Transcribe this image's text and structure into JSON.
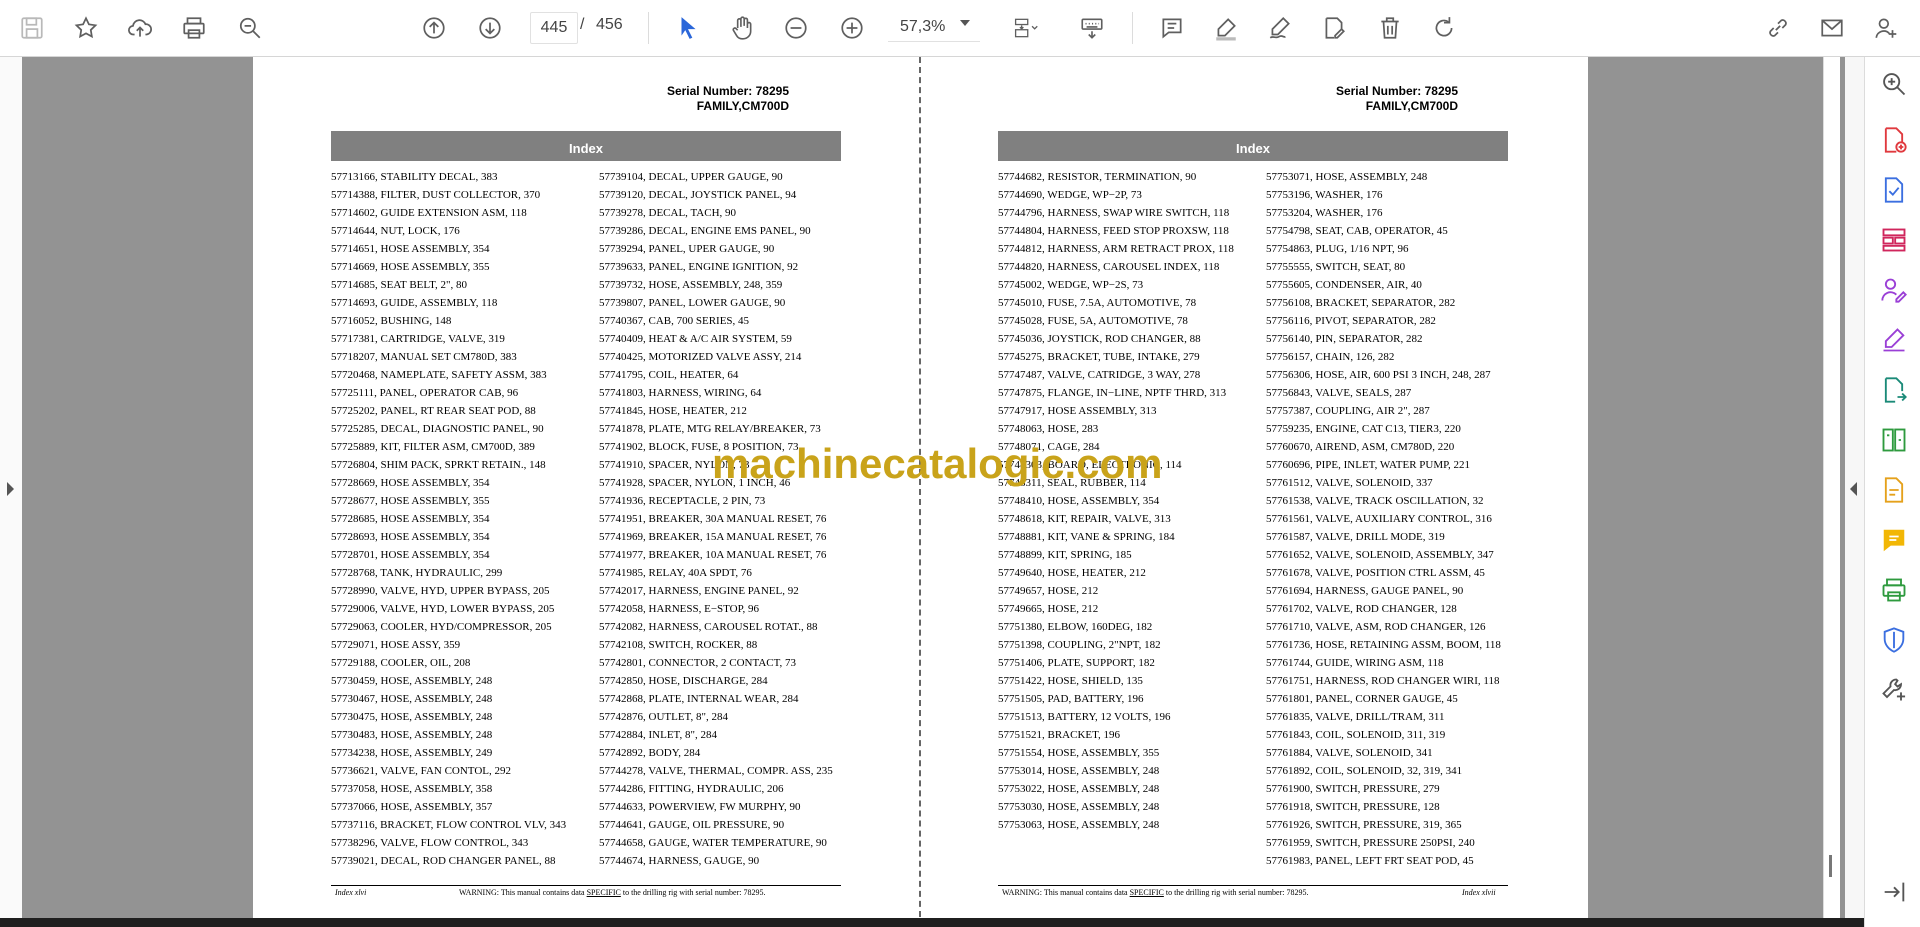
{
  "toolbar": {
    "page_current": "445",
    "page_separator": "/",
    "page_total": "456",
    "zoom": "57,3%"
  },
  "pages": [
    {
      "serial": "Serial Number: 78295",
      "family": "FAMILY,CM700D",
      "index_title": "Index",
      "col1": [
        "57713166, STABILITY DECAL, 383",
        "57714388, FILTER, DUST COLLECTOR, 370",
        "57714602, GUIDE EXTENSION ASM, 118",
        "57714644, NUT, LOCK, 176",
        "57714651, HOSE ASSEMBLY, 354",
        "57714669, HOSE ASSEMBLY, 355",
        "57714685, SEAT BELT, 2\", 80",
        "57714693, GUIDE, ASSEMBLY, 118",
        "57716052, BUSHING, 148",
        "57717381, CARTRIDGE, VALVE, 319",
        "57718207, MANUAL SET CM780D, 383",
        "57720468, NAMEPLATE, SAFETY ASSM, 383",
        "57725111, PANEL, OPERATOR CAB, 96",
        "57725202, PANEL, RT REAR SEAT POD, 88",
        "57725285, DECAL, DIAGNOSTIC PANEL, 90",
        "57725889, KIT, FILTER ASM, CM700D, 389",
        "57726804, SHIM PACK, SPRKT RETAIN., 148",
        "57728669, HOSE ASSEMBLY, 354",
        "57728677, HOSE ASSEMBLY, 355",
        "57728685, HOSE ASSEMBLY, 354",
        "57728693, HOSE ASSEMBLY, 354",
        "57728701, HOSE ASSEMBLY, 354",
        "57728768, TANK, HYDRAULIC, 299",
        "57728990, VALVE, HYD, UPPER BYPASS, 205",
        "57729006, VALVE, HYD, LOWER BYPASS, 205",
        "57729063, COOLER, HYD/COMPRESSOR, 205",
        "57729071, HOSE ASSY, 359",
        "57729188, COOLER, OIL, 208",
        "57730459, HOSE, ASSEMBLY, 248",
        "57730467, HOSE, ASSEMBLY, 248",
        "57730475, HOSE, ASSEMBLY, 248",
        "57730483, HOSE, ASSEMBLY, 248",
        "57734238, HOSE, ASSEMBLY, 249",
        "57736621, VALVE, FAN CONTOL, 292",
        "57737058, HOSE, ASSEMBLY, 358",
        "57737066, HOSE, ASSEMBLY, 357",
        "57737116, BRACKET, FLOW CONTROL VLV, 343",
        "57738296, VALVE, FLOW CONTROL, 343",
        "57739021, DECAL, ROD CHANGER PANEL, 88"
      ],
      "col2": [
        "57739104, DECAL, UPPER GAUGE, 90",
        "57739120, DECAL, JOYSTICK PANEL, 94",
        "57739278, DECAL, TACH, 90",
        "57739286, DECAL, ENGINE EMS PANEL, 90",
        "57739294, PANEL, UPER GAUGE, 90",
        "57739633, PANEL, ENGINE IGNITION, 92",
        "57739732, HOSE, ASSEMBLY, 248, 359",
        "57739807, PANEL, LOWER GAUGE, 90",
        "57740367, CAB, 700 SERIES, 45",
        "57740409, HEAT & A/C AIR SYSTEM, 59",
        "57740425, MOTORIZED VALVE ASSY, 214",
        "57741795, COIL, HEATER, 64",
        "57741803, HARNESS, WIRING, 64",
        "57741845, HOSE, HEATER, 212",
        "57741878, PLATE, MTG RELAY/BREAKER, 73",
        "57741902, BLOCK, FUSE, 8 POSITION, 73",
        "57741910, SPACER, NYLON, 73",
        "57741928, SPACER, NYLON, 1 INCH, 46",
        "57741936, RECEPTACLE, 2 PIN, 73",
        "57741951, BREAKER, 30A MANUAL RESET, 76",
        "57741969, BREAKER, 15A MANUAL RESET, 76",
        "57741977, BREAKER, 10A MANUAL RESET, 76",
        "57741985, RELAY, 40A SPDT, 76",
        "57742017, HARNESS, ENGINE PANEL, 92",
        "57742058, HARNESS, E−STOP, 96",
        "57742082, HARNESS, CAROUSEL ROTAT., 88",
        "57742108, SWITCH, ROCKER, 88",
        "57742801, CONNECTOR, 2 CONTACT, 73",
        "57742850, HOSE, DISCHARGE, 284",
        "57742868, PLATE, INTERNAL WEAR, 284",
        "57742876, OUTLET, 8\", 284",
        "57742884, INLET, 8\", 284",
        "57742892, BODY, 284",
        "57744278, VALVE, THERMAL, COMPR. ASS, 235",
        "57744286, FITTING, HYDRAULIC, 206",
        "57744633, POWERVIEW, FW MURPHY, 90",
        "57744641, GAUGE, OIL PRESSURE, 90",
        "57744658, GAUGE, WATER TEMPERATURE, 90",
        "57744674, HARNESS, GAUGE, 90"
      ],
      "footer_left": "Index xlvi",
      "footer_warning_pre": "WARNING:  This manual contains data ",
      "footer_warning_u": "SPECIFIC",
      "footer_warning_post": " to the drilling rig with serial number: 78295."
    },
    {
      "serial": "Serial Number: 78295",
      "family": "FAMILY,CM700D",
      "index_title": "Index",
      "col1": [
        "57744682, RESISTOR, TERMINATION, 90",
        "57744690, WEDGE, WP−2P, 73",
        "57744796, HARNESS, SWAP WIRE SWITCH, 118",
        "57744804, HARNESS, FEED STOP PROXSW, 118",
        "57744812, HARNESS, ARM RETRACT PROX, 118",
        "57744820, HARNESS, CAROUSEL INDEX, 118",
        "57745002, WEDGE, WP−2S, 73",
        "57745010, FUSE, 7.5A, AUTOMOTIVE, 78",
        "57745028, FUSE, 5A, AUTOMOTIVE, 78",
        "57745036, JOYSTICK, ROD CHANGER, 88",
        "57745275, BRACKET, TUBE, INTAKE, 279",
        "57747487, VALVE, CATRIDGE, 3 WAY, 278",
        "57747875, FLANGE, IN−LINE, NPTF THRD, 313",
        "57747917, HOSE ASSEMBLY, 313",
        "57748063, HOSE, 283",
        "57748071, CAGE, 284",
        "57748303, BOARD, ELECTRONIC, 114",
        "57748311, SEAL, RUBBER, 114",
        "57748410, HOSE, ASSEMBLY, 354",
        "57748618, KIT, REPAIR, VALVE, 313",
        "57748881, KIT, VANE & SPRING, 184",
        "57748899, KIT, SPRING, 185",
        "57749640, HOSE, HEATER, 212",
        "57749657, HOSE, 212",
        "57749665, HOSE, 212",
        "57751380, ELBOW, 160DEG, 182",
        "57751398, COUPLING, 2\"NPT, 182",
        "57751406, PLATE, SUPPORT, 182",
        "57751422, HOSE, SHIELD, 135",
        "57751505, PAD, BATTERY, 196",
        "57751513, BATTERY, 12 VOLTS, 196",
        "57751521, BRACKET, 196",
        "57751554, HOSE, ASSEMBLY, 355",
        "57753014, HOSE, ASSEMBLY, 248",
        "57753022, HOSE, ASSEMBLY, 248",
        "57753030, HOSE, ASSEMBLY, 248",
        "57753063, HOSE, ASSEMBLY, 248"
      ],
      "col2": [
        "57753071, HOSE, ASSEMBLY, 248",
        "57753196, WASHER, 176",
        "57753204, WASHER, 176",
        "57754798, SEAT, CAB, OPERATOR, 45",
        "57754863, PLUG, 1/16 NPT, 96",
        "57755555, SWITCH, SEAT, 80",
        "57755605, CONDENSER, AIR, 40",
        "57756108, BRACKET, SEPARATOR, 282",
        "57756116, PIVOT, SEPARATOR, 282",
        "57756140, PIN, SEPARATOR, 282",
        "57756157, CHAIN, 126, 282",
        "57756306, HOSE, AIR, 600 PSI 3 INCH, 248, 287",
        "57756843, VALVE, SEALS, 287",
        "57757387, COUPLING, AIR 2\", 287",
        "57759235, ENGINE, CAT C13, TIER3, 220",
        "57760670, AIREND, ASM, CM780D, 220",
        "57760696, PIPE, INLET, WATER PUMP, 221",
        "57761512, VALVE, SOLENOID, 337",
        "57761538, VALVE, TRACK OSCILLATION, 32",
        "57761561, VALVE, AUXILIARY CONTROL, 316",
        "57761587, VALVE, DRILL MODE, 319",
        "57761652, VALVE, SOLENOID, ASSEMBLY, 347",
        "57761678, VALVE, POSITION CTRL ASSM, 45",
        "57761694, HARNESS, GAUGE PANEL, 90",
        "57761702, VALVE, ROD CHANGER, 128",
        "57761710, VALVE, ASM, ROD CHANGER, 126",
        "57761736, HOSE, RETAINING ASSM, BOOM, 118",
        "57761744, GUIDE, WIRING ASM, 118",
        "57761751, HARNESS, ROD CHANGER WIRI, 118",
        "57761801, PANEL, CORNER GAUGE, 45",
        "57761835, VALVE, DRILL/TRAM, 311",
        "57761843, COIL, SOLENOID, 311, 319",
        "57761884, VALVE, SOLENOID, 341",
        "57761892, COIL, SOLENOID, 32, 319, 341",
        "57761900, SWITCH, PRESSURE, 279",
        "57761918, SWITCH, PRESSURE, 128",
        "57761926, SWITCH, PRESSURE, 319, 365",
        "57761959, SWITCH, PRESSURE 250PSI, 240",
        "57761983, PANEL, LEFT FRT SEAT POD, 45"
      ],
      "footer_right": "Index xlvii",
      "footer_warning_pre": "WARNING:  This manual contains data ",
      "footer_warning_u": "SPECIFIC",
      "footer_warning_post": " to the drilling rig with serial number: 78295."
    }
  ],
  "watermark": "machinecatalogic.com"
}
